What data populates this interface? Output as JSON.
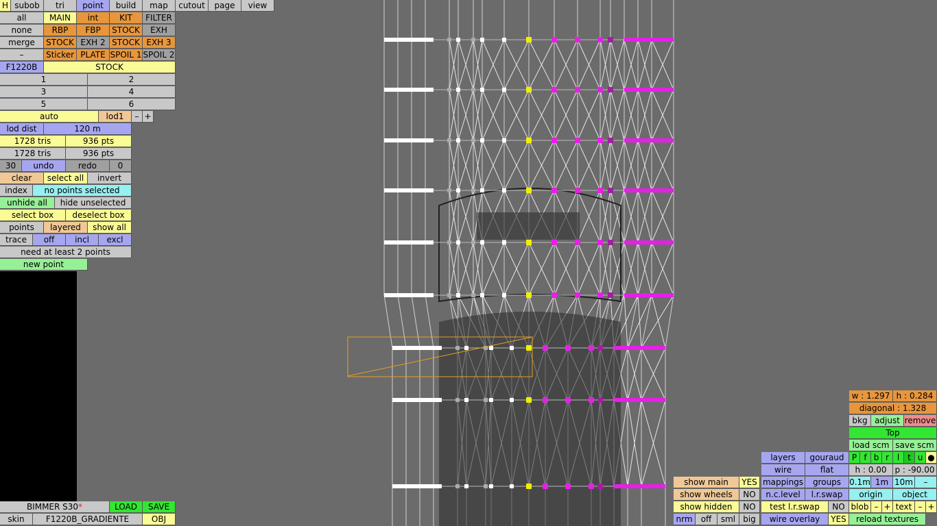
{
  "top_menu": [
    "H",
    "subob",
    "tri",
    "point",
    "build",
    "map",
    "cutout",
    "page",
    "view"
  ],
  "layer_panel": {
    "row1": [
      "all",
      "MAIN",
      "int",
      "KIT",
      "FILTER"
    ],
    "row2": [
      "none",
      "RBP",
      "FBP",
      "STOCK",
      "EXH"
    ],
    "row3": [
      "merge",
      "STOCK",
      "EXH 2",
      "STOCK",
      "EXH 3"
    ],
    "row4": [
      "–",
      "Sticker",
      "PLATE",
      "SPOIL 1",
      "SPOIL 2"
    ],
    "model_code": "F1220B",
    "model_variant": "STOCK",
    "slots": [
      "1",
      "2",
      "3",
      "4",
      "5",
      "6"
    ]
  },
  "lod": {
    "mode": "auto",
    "level": "lod1",
    "minus": "–",
    "plus": "+",
    "dist_label": "lod dist",
    "dist_value": "120 m"
  },
  "stats": {
    "tris_a": "1728 tris",
    "pts_a": "936 pts",
    "tris_b": "1728 tris",
    "pts_b": "936 pts"
  },
  "history": {
    "count": "30",
    "undo": "undo",
    "redo": "redo",
    "redo_count": "0"
  },
  "selection": {
    "clear": "clear",
    "select_all": "select all",
    "invert": "invert",
    "index": "index",
    "status": "no points selected",
    "unhide_all": "unhide all",
    "hide_unselected": "hide unselected",
    "select_box": "select box",
    "deselect_box": "deselect box",
    "points": "points",
    "layered": "layered",
    "show_all": "show all",
    "trace": "trace",
    "off": "off",
    "incl": "incl",
    "excl": "excl",
    "hint": "need at least 2 points",
    "new_point": "new point"
  },
  "file": {
    "name": "BIMMER S30",
    "modified_mark": "*",
    "load": "LOAD",
    "save": "SAVE",
    "skin": "skin",
    "skin_name": "F1220B_GRADIENTE",
    "obj": "OBJ"
  },
  "view_panel": {
    "w": "w : 1.297",
    "h": "h : 0.284",
    "diagonal": "diagonal : 1.328",
    "bkg": "bkg",
    "adjust": "adjust",
    "remove": "remove",
    "view_name": "Top",
    "load_scm": "load scm",
    "save_scm": "save scm",
    "view_letters": [
      "P",
      "f",
      "b",
      "r",
      "l",
      "t",
      "u",
      "●"
    ],
    "h_val": "h : 0.00",
    "p_val": "p : -90.00",
    "grid": [
      "0.1m",
      "1m",
      "10m",
      "–"
    ],
    "origin": "origin",
    "object": "object",
    "blob": "blob",
    "text": "text",
    "pm": [
      "–",
      "+"
    ],
    "reload": "reload textures"
  },
  "render_panel": {
    "layers": "layers",
    "gouraud": "gouraud",
    "wire": "wire",
    "flat": "flat",
    "mappings": "mappings",
    "groups": "groups",
    "nclevel": "n.c.level",
    "lrswap": "l.r.swap",
    "test_lrswap": "test l.r.swap",
    "test_val": "NO",
    "wire_overlay": "wire overlay",
    "overlay_val": "YES"
  },
  "show_panel": {
    "show_main": "show main",
    "main_val": "YES",
    "show_wheels": "show wheels",
    "wheels_val": "NO",
    "show_hidden": "show hidden",
    "hidden_val": "NO",
    "modes": [
      "nrm",
      "off",
      "sml",
      "big"
    ]
  },
  "colors": {
    "selected": "#a6a6f0",
    "white_pt": "#ffffff",
    "yellow_pt": "#f0f000",
    "magenta_pt": "#e620e6",
    "purple_pt": "#a020a0"
  }
}
